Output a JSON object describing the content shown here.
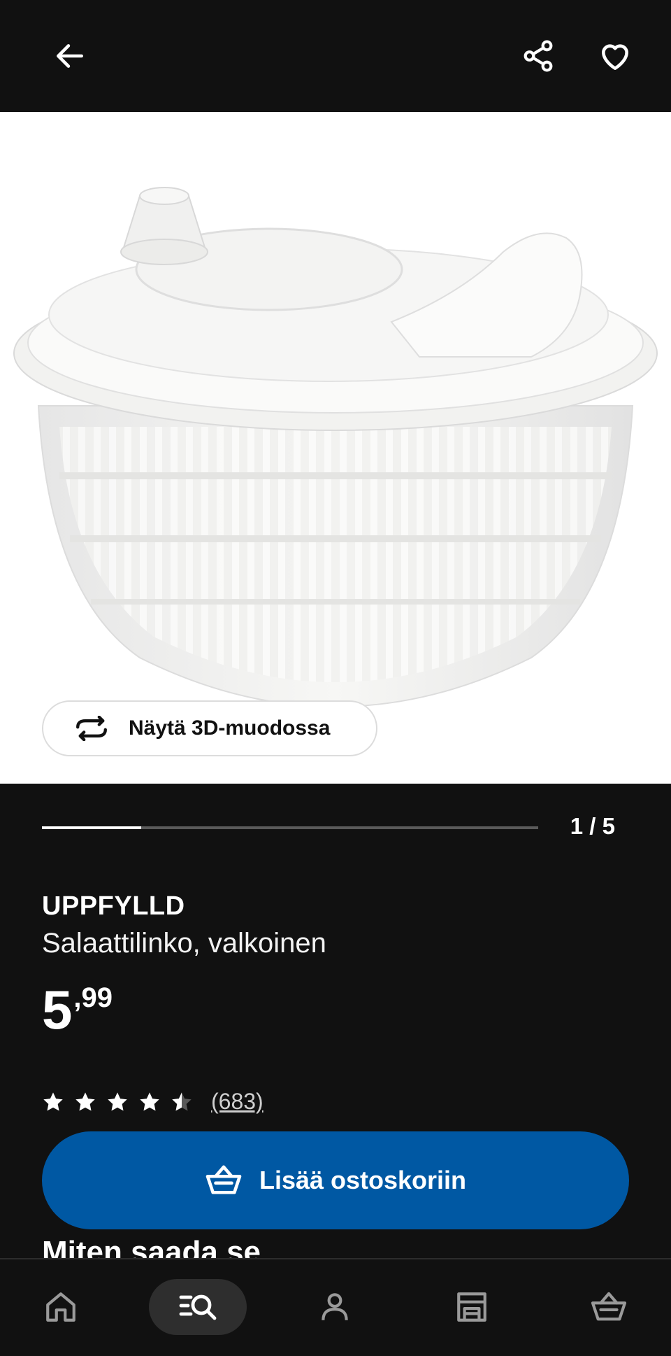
{
  "header": {
    "back_icon": "arrow-left-icon",
    "share_icon": "share-icon",
    "favourite_icon": "heart-outline-icon"
  },
  "gallery": {
    "view_3d_label": "Näytä 3D-muodossa",
    "view_3d_icon": "rotate-arrows-icon",
    "current_image": 1,
    "total_images": 5,
    "counter_text": "1 / 5",
    "progress_fraction": 0.2
  },
  "product": {
    "brand": "UPPFYLLD",
    "description": "Salaattilinko, valkoinen",
    "price_integer": "5",
    "price_decimal": ",99",
    "rating_value": 4.5,
    "rating_max": 5,
    "review_count": "(683)"
  },
  "actions": {
    "add_to_cart_label": "Lisää ostoskoriin",
    "add_to_cart_icon": "basket-icon",
    "accent_color": "#0058a3"
  },
  "sections": {
    "how_to_get_title": "Miten saada se"
  },
  "bottom_nav": {
    "items": [
      {
        "icon": "home-icon",
        "active": false
      },
      {
        "icon": "search-browse-icon",
        "active": true
      },
      {
        "icon": "profile-icon",
        "active": false
      },
      {
        "icon": "store-icon",
        "active": false
      },
      {
        "icon": "basket-icon",
        "active": false
      }
    ]
  }
}
